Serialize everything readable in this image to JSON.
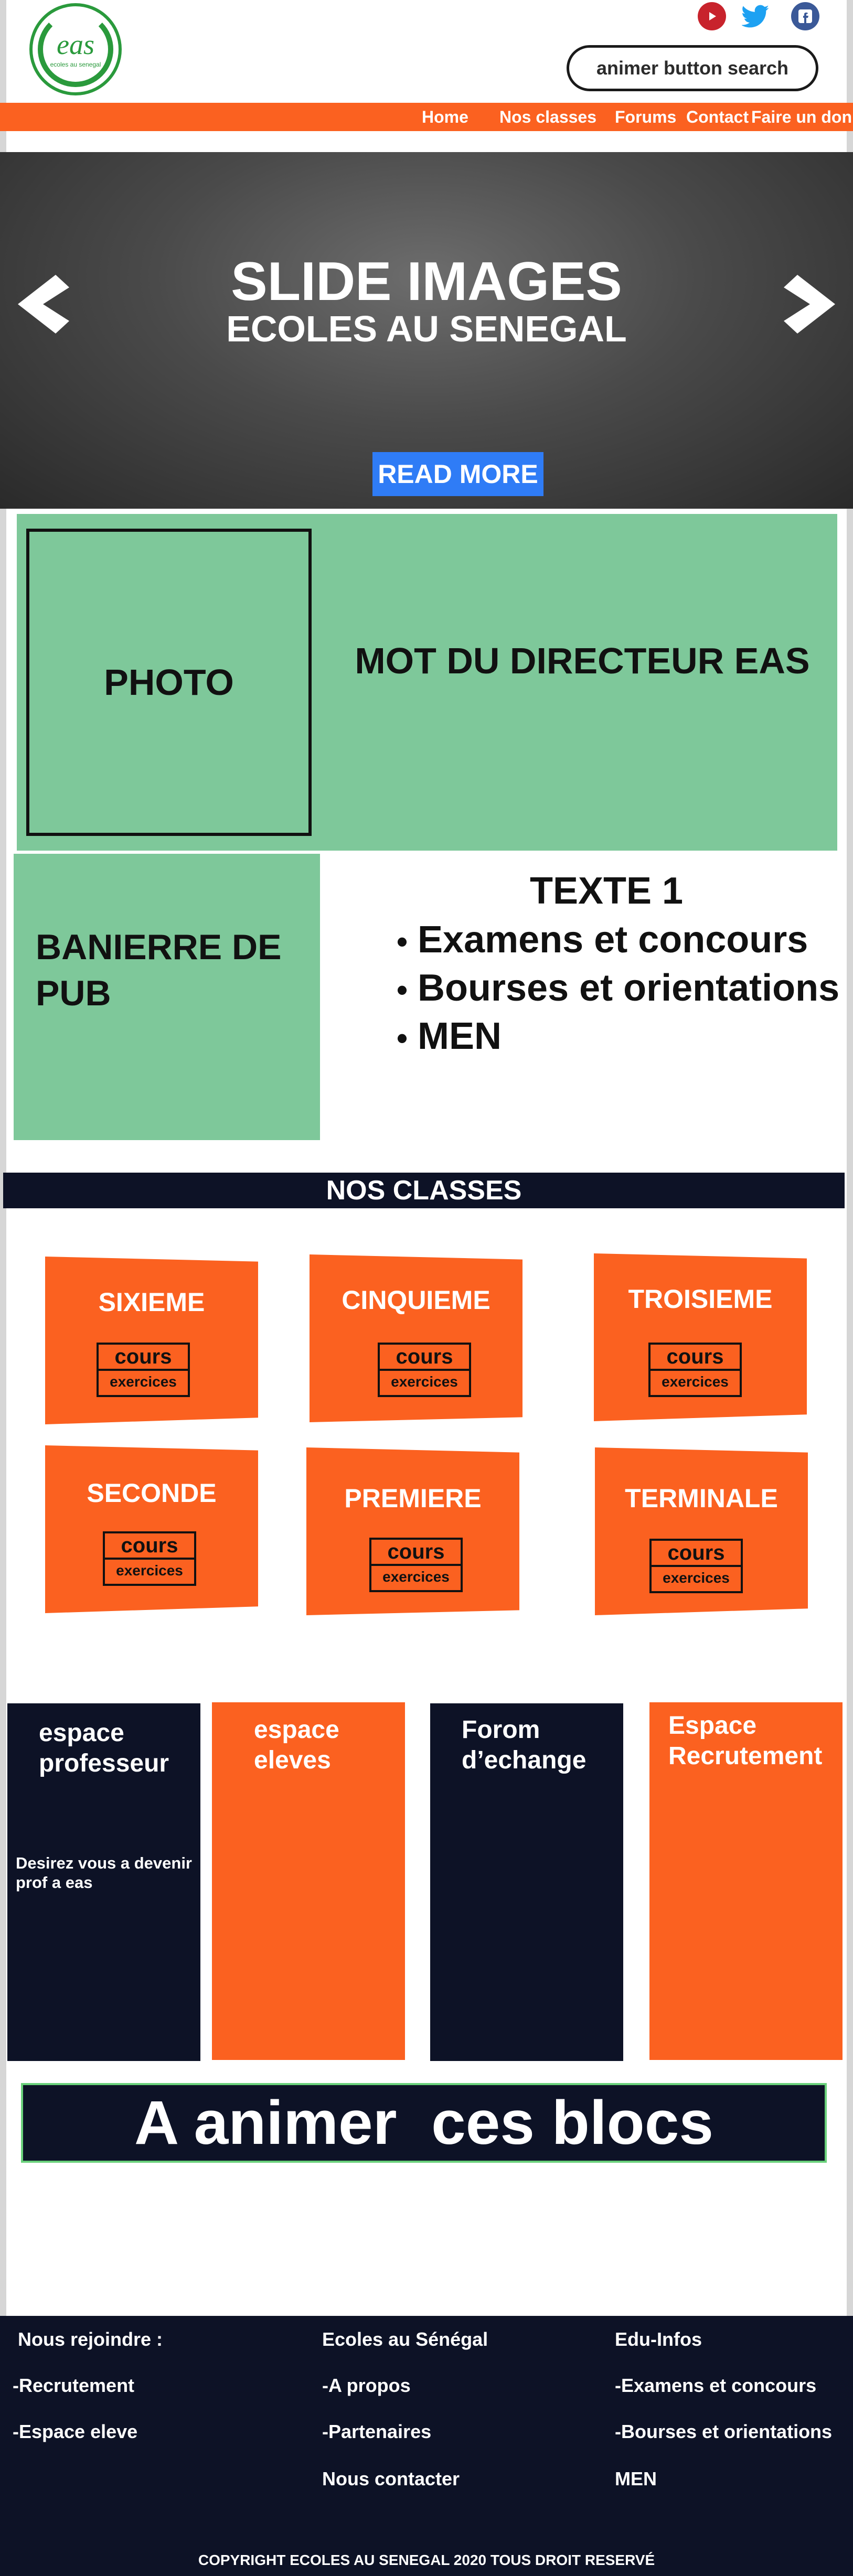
{
  "header": {
    "logo_text": "eas",
    "logo_sub": "ecoles au senegal",
    "search_button": "animer button search",
    "social": {
      "youtube": "youtube-icon",
      "twitter": "twitter-icon",
      "facebook": "facebook-icon"
    }
  },
  "nav": {
    "items": [
      "Home",
      "Nos classes",
      "Forums",
      "Contact",
      "Faire un don"
    ]
  },
  "slider": {
    "title": "SLIDE IMAGES",
    "subtitle": "ECOLES AU SENEGAL",
    "read_more": "READ MORE"
  },
  "director": {
    "photo": "PHOTO",
    "text": "MOT DU DIRECTEUR EAS"
  },
  "pub": {
    "text": "BANIERRE DE PUB"
  },
  "texte": {
    "title": "TEXTE 1",
    "items": [
      "Examens et concours",
      "Bourses et orientations",
      "MEN"
    ]
  },
  "classes": {
    "heading": "NOS CLASSES",
    "cours_label": "cours",
    "exercices_label": "exercices",
    "items": [
      "SIXIEME",
      "CINQUIEME",
      "TROISIEME",
      "SECONDE",
      "PREMIERE",
      "TERMINALE"
    ]
  },
  "espaces": {
    "professeur": "espace professeur",
    "professeur_text": "Desirez vous a devenir prof a eas",
    "eleves": "espace eleves",
    "forum": "Forom d’echange",
    "recrutement": "Espace Recrutement"
  },
  "animer": "A animer  ces blocs",
  "footer": {
    "col1": [
      "Nous rejoindre :",
      "-Recrutement",
      "-Espace eleve"
    ],
    "col2": [
      "Ecoles au Sénégal",
      "-A propos",
      "-Partenaires",
      "Nous contacter"
    ],
    "col3": [
      "Edu-Infos",
      "-Examens et concours",
      "-Bourses et orientations",
      "MEN"
    ],
    "copyright": "COPYRIGHT ECOLES AU SENEGAL 2020 TOUS DROIT RESERVÉ"
  },
  "colors": {
    "orange": "#fb6120",
    "navy": "#0d1226",
    "green": "#7ec89a",
    "blue": "#2f7cf6"
  }
}
